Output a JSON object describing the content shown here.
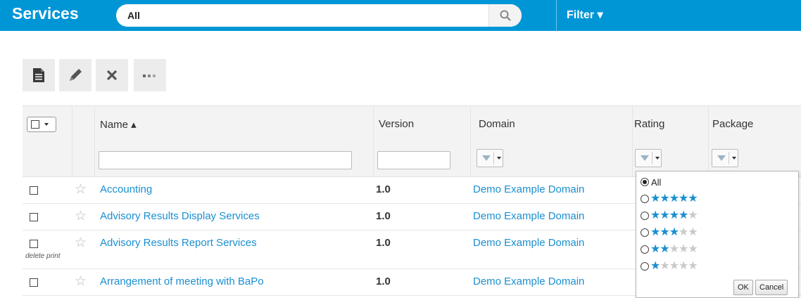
{
  "header": {
    "title": "Services",
    "search_value": "All",
    "filter_label": "Filter ▾"
  },
  "toolbar": {
    "buttons": [
      "new-document-icon",
      "edit-icon",
      "delete-icon",
      "more-icon"
    ]
  },
  "table": {
    "headers": {
      "name": "Name ▴",
      "version": "Version",
      "domain": "Domain",
      "rating": "Rating",
      "package": "Package"
    },
    "rows": [
      {
        "name": "Accounting",
        "version": "1.0",
        "domain": "Demo Example Domain",
        "actions": ""
      },
      {
        "name": "Advisory Results Display Services",
        "version": "1.0",
        "domain": "Demo Example Domain",
        "actions": ""
      },
      {
        "name": "Advisory Results Report Services",
        "version": "1.0",
        "domain": "Demo Example Domain",
        "actions": "delete print"
      },
      {
        "name": "Arrangement of meeting with BaPo",
        "version": "1.0",
        "domain": "Demo Example Domain",
        "actions": ""
      }
    ]
  },
  "rating_popup": {
    "options": [
      {
        "label": "All",
        "stars": null,
        "selected": true
      },
      {
        "label": "",
        "stars": 5,
        "selected": false
      },
      {
        "label": "",
        "stars": 4,
        "selected": false
      },
      {
        "label": "",
        "stars": 3,
        "selected": false
      },
      {
        "label": "",
        "stars": 2,
        "selected": false
      },
      {
        "label": "",
        "stars": 1,
        "selected": false
      }
    ],
    "ok_label": "OK",
    "cancel_label": "Cancel"
  },
  "colors": {
    "header_bg": "#0096d6",
    "link": "#1a8fd0",
    "star_active": "#1a8fd0"
  }
}
